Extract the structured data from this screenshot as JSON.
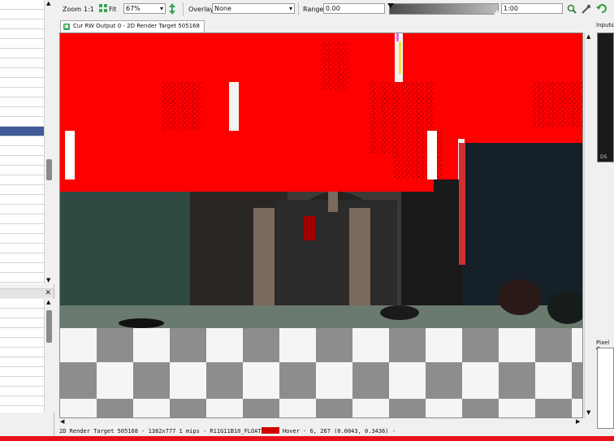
{
  "toolbar": {
    "zoom_label": "Zoom",
    "zoom_1to1": "1:1",
    "fit_label": "Fit",
    "zoom_value": "67%",
    "overlay_label": "Overlay",
    "overlay_value": "None",
    "range_label": "Range",
    "range_min": "0.00",
    "range_max": "1:00"
  },
  "tab": {
    "label": "Cur RW Output 0 - 2D Render Target 505168"
  },
  "right_panel": {
    "inputs_label": "Inputs",
    "inputs_small": "DS",
    "pixel_label": "Pixel C"
  },
  "status": {
    "text_before_swatch": "2D Render Target 505168 - 1382x777 1 mips - R11G11B10_FLOAT",
    "text_after_swatch": " Hover -     6,  267 (0.0043, 0.3436)  -",
    "swatch_color": "#d00000"
  },
  "colors": {
    "accent_selection": "#3f5c99",
    "bottom_bar": "#e8101a",
    "clear_red": "#ff0000"
  }
}
